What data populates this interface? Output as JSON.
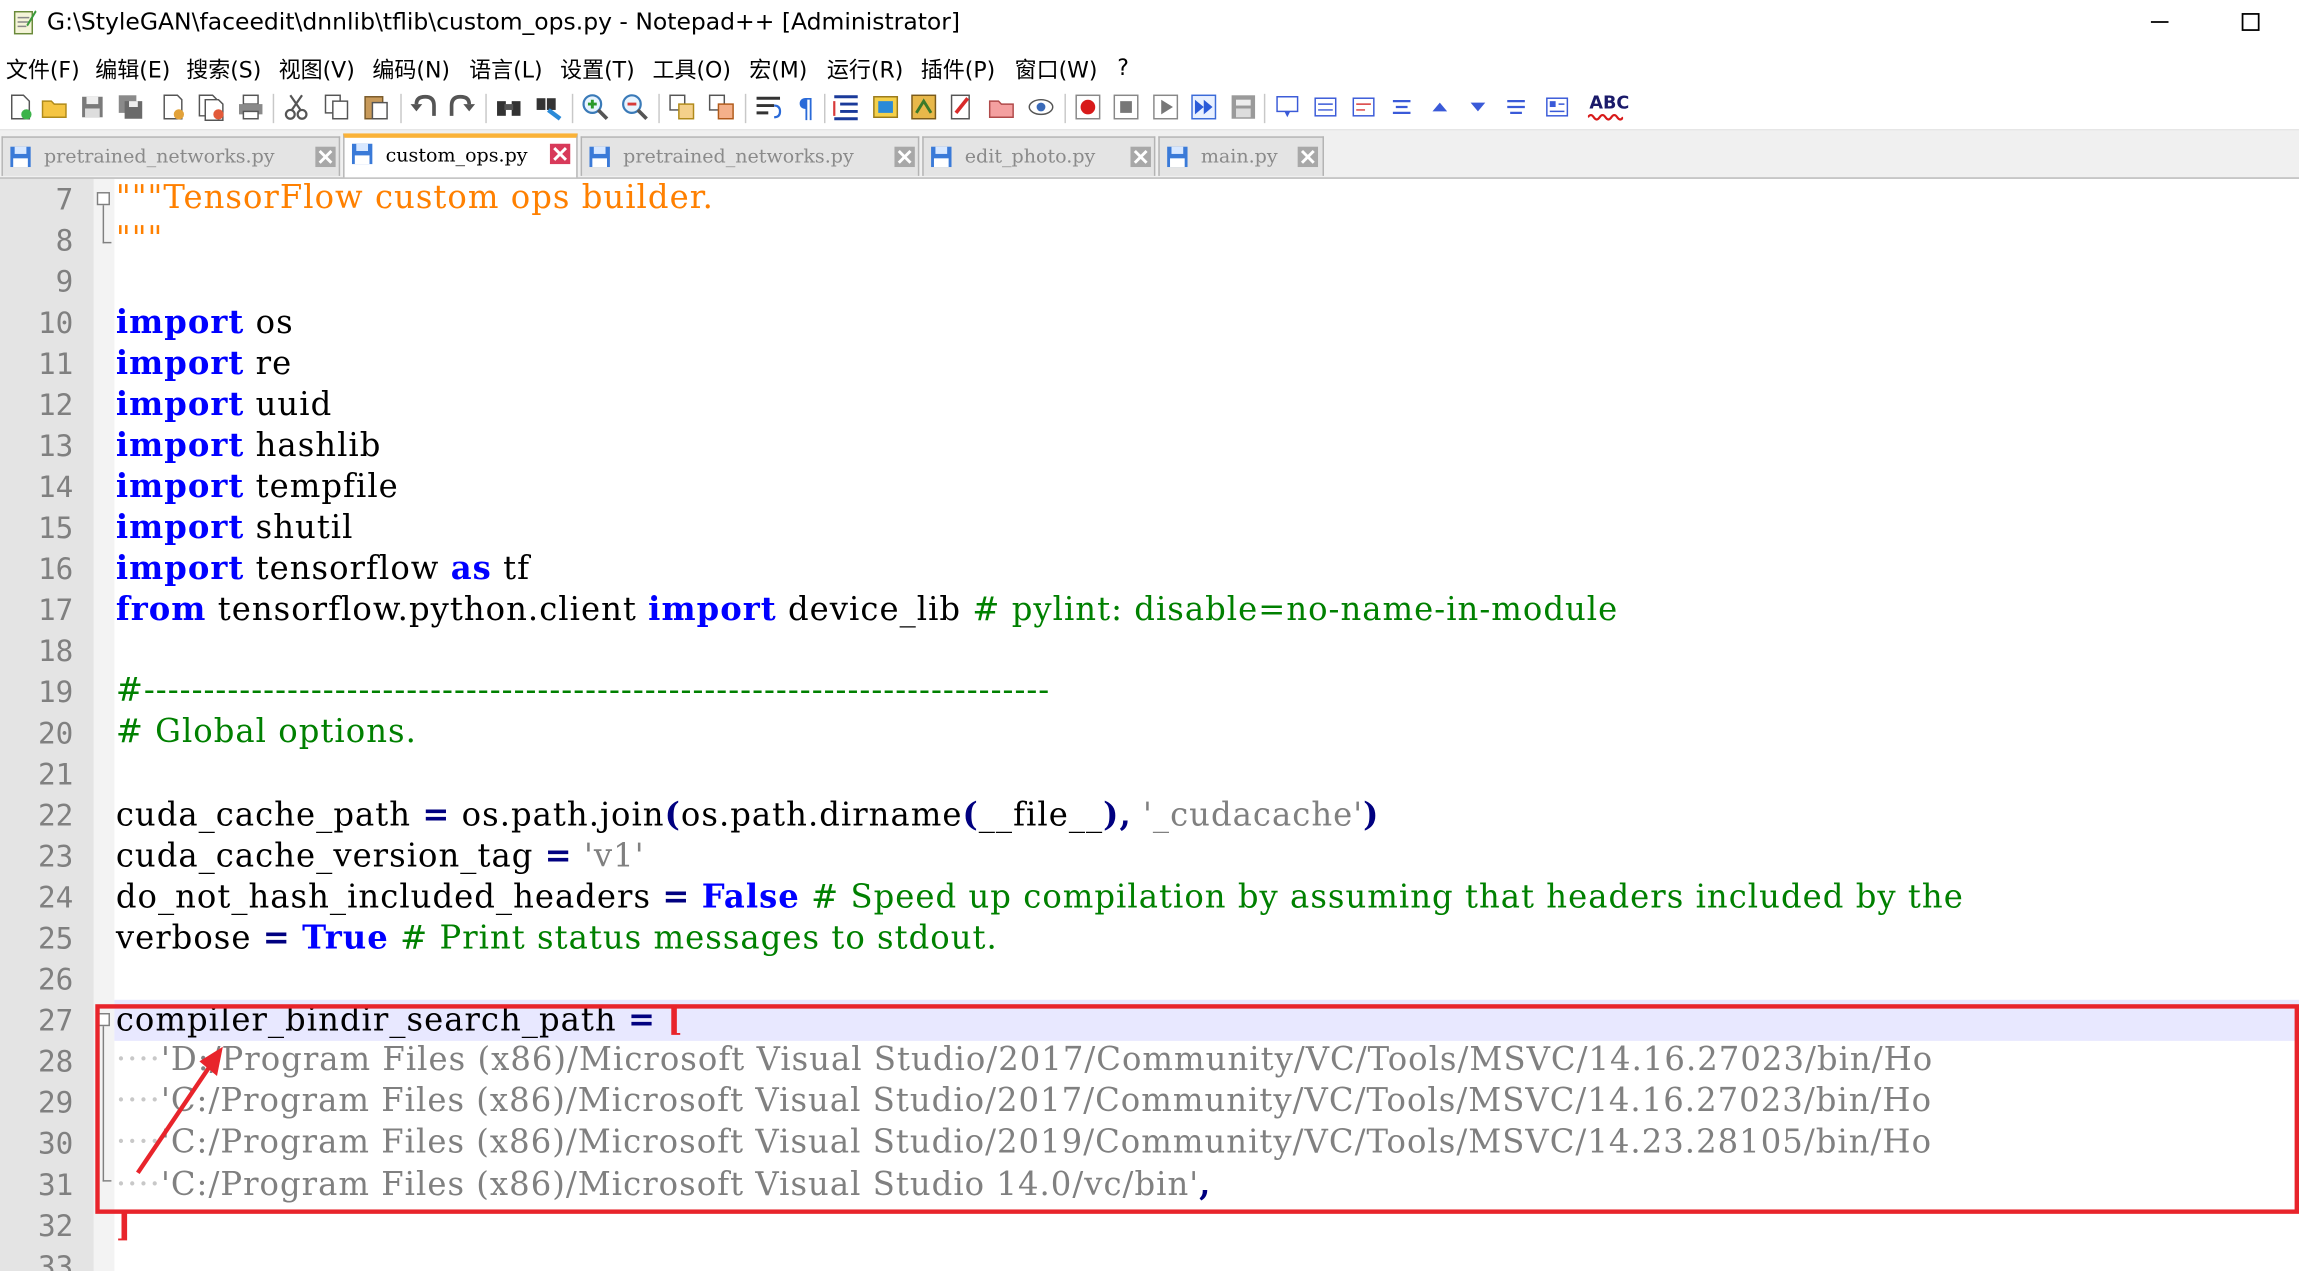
{
  "window": {
    "title": "G:\\StyleGAN\\faceedit\\dnnlib\\tflib\\custom_ops.py - Notepad++ [Administrator]"
  },
  "menu": [
    "文件(F)",
    "编辑(E)",
    "搜索(S)",
    "视图(V)",
    "编码(N)",
    "语言(L)",
    "设置(T)",
    "工具(O)",
    "宏(M)",
    "运行(R)",
    "插件(P)",
    "窗口(W)",
    "?"
  ],
  "toolbar": {
    "spellcheck_label": "ABC"
  },
  "tabs": [
    {
      "label": "pretrained_networks.py",
      "active": false
    },
    {
      "label": "custom_ops.py",
      "active": true
    },
    {
      "label": "pretrained_networks.py",
      "active": false
    },
    {
      "label": "edit_photo.py",
      "active": false
    },
    {
      "label": "main.py",
      "active": false
    }
  ],
  "editor": {
    "line_numbers": [
      "7",
      "8",
      "9",
      "10",
      "11",
      "12",
      "13",
      "14",
      "15",
      "16",
      "17",
      "18",
      "19",
      "20",
      "21",
      "22",
      "23",
      "24",
      "25",
      "26",
      "27",
      "28",
      "29",
      "30",
      "31",
      "32",
      "33"
    ],
    "lines": {
      "l7": {
        "doc": "\"\"\"TensorFlow custom ops builder."
      },
      "l8": {
        "doc": "\"\"\""
      },
      "l10": {
        "kw": "import",
        "rest": " os"
      },
      "l11": {
        "kw": "import",
        "rest": " re"
      },
      "l12": {
        "kw": "import",
        "rest": " uuid"
      },
      "l13": {
        "kw": "import",
        "rest": " hashlib"
      },
      "l14": {
        "kw": "import",
        "rest": " tempfile"
      },
      "l15": {
        "kw": "import",
        "rest": " shutil"
      },
      "l16": {
        "kw": "import",
        "mid": " tensorflow ",
        "kw2": "as",
        "rest": " tf"
      },
      "l17": {
        "kw": "from",
        "mid": " tensorflow.python.client ",
        "kw2": "import",
        "rest": " device_lib ",
        "cmt": "# pylint: disable=no-name-in-module"
      },
      "l19": {
        "cmt": "#----------------------------------------------------------------------------"
      },
      "l20": {
        "cmt": "# Global options."
      },
      "l22": {
        "a": "cuda_cache_path ",
        "op1": "=",
        "b": " os.path.join",
        "op2": "(",
        "c": "os.path.dirname",
        "op3": "(",
        "d": "__file__",
        "op4": "),",
        "e": " ",
        "str": "'_cudacache'",
        "op5": ")"
      },
      "l23": {
        "a": "cuda_cache_version_tag ",
        "op1": "=",
        "b": " ",
        "str": "'v1'"
      },
      "l24": {
        "a": "do_not_hash_included_headers ",
        "op1": "=",
        "b": " ",
        "kw": "False",
        "c": " ",
        "cmt": "# Speed up compilation by assuming that headers included by the"
      },
      "l25": {
        "a": "verbose ",
        "op1": "=",
        "b": " ",
        "kw": "True",
        "c": " ",
        "cmt": "# Print status messages to stdout."
      },
      "l27": {
        "a": "compiler_bindir_search_path ",
        "op1": "=",
        "b": " ",
        "op2": "["
      },
      "l28": {
        "ws": "····",
        "str": "'D:/Program Files (x86)/Microsoft Visual Studio/2017/Community/VC/Tools/MSVC/14.16.27023/bin/Ho"
      },
      "l29": {
        "ws": "····",
        "str": "'C:/Program Files (x86)/Microsoft Visual Studio/2017/Community/VC/Tools/MSVC/14.16.27023/bin/Ho"
      },
      "l30": {
        "ws": "····",
        "str": "'C:/Program Files (x86)/Microsoft Visual Studio/2019/Community/VC/Tools/MSVC/14.23.28105/bin/Ho"
      },
      "l31": {
        "ws": "····",
        "str": "'C:/Program Files (x86)/Microsoft Visual Studio 14.0/vc/bin'",
        "op": ","
      },
      "l32": {
        "op": "]"
      }
    }
  },
  "colors": {
    "highlight_border": "#e8242b",
    "keyword": "#0000ff",
    "comment": "#008000",
    "docstring": "#ff8000",
    "string": "#808080"
  }
}
